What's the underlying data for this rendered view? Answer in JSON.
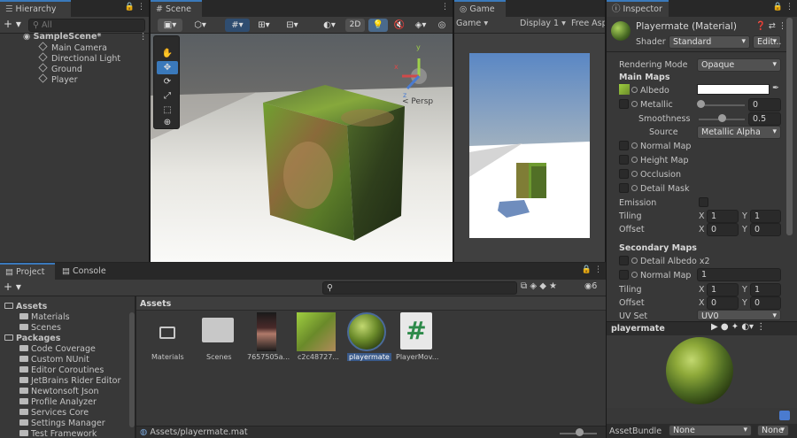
{
  "hierarchy": {
    "tab": "Hierarchy",
    "search_placeholder": "All",
    "scene": "SampleScene*",
    "items": [
      "Main Camera",
      "Directional Light",
      "Ground",
      "Player"
    ]
  },
  "scene": {
    "tab": "Scene",
    "mode_2d": "2D",
    "persp": "< Persp"
  },
  "game": {
    "tab": "Game",
    "display_dropdown": "Game",
    "display": "Display 1",
    "aspect": "Free Asp"
  },
  "inspector": {
    "tab": "Inspector",
    "material_name": "Playermate (Material)",
    "shader_label": "Shader",
    "shader_value": "Standard",
    "edit_button": "Edit...",
    "rendering_mode_label": "Rendering Mode",
    "rendering_mode_value": "Opaque",
    "main_maps_heading": "Main Maps",
    "albedo": "Albedo",
    "metallic": "Metallic",
    "metallic_value": "0",
    "smoothness": "Smoothness",
    "smoothness_value": "0.5",
    "source": "Source",
    "source_value": "Metallic Alpha",
    "normal_map": "Normal Map",
    "height_map": "Height Map",
    "occlusion": "Occlusion",
    "detail_mask": "Detail Mask",
    "emission": "Emission",
    "tiling": "Tiling",
    "offset": "Offset",
    "x": "X",
    "y": "Y",
    "tiling_x": "1",
    "tiling_y": "1",
    "offset_x": "0",
    "offset_y": "0",
    "secondary_maps_heading": "Secondary Maps",
    "detail_albedo": "Detail Albedo x2",
    "normal_map_2": "Normal Map",
    "normal_map_2_value": "1",
    "tiling2_x": "1",
    "tiling2_y": "1",
    "offset2_x": "0",
    "offset2_y": "0",
    "uv_set": "UV Set",
    "uv_set_value": "UV0",
    "preview_name": "playermate",
    "assetbundle_label": "AssetBundle",
    "assetbundle_value": "None",
    "assetbundle_variant": "None"
  },
  "project": {
    "tab_project": "Project",
    "tab_console": "Console",
    "hidden_count": "6",
    "assets_header": "Assets",
    "tree": [
      {
        "label": "Assets",
        "bold": true
      },
      {
        "label": "Materials"
      },
      {
        "label": "Scenes"
      },
      {
        "label": "Packages",
        "bold": true
      },
      {
        "label": "Code Coverage"
      },
      {
        "label": "Custom NUnit"
      },
      {
        "label": "Editor Coroutines"
      },
      {
        "label": "JetBrains Rider Editor"
      },
      {
        "label": "Newtonsoft Json"
      },
      {
        "label": "Profile Analyzer"
      },
      {
        "label": "Services Core"
      },
      {
        "label": "Settings Manager"
      },
      {
        "label": "Test Framework"
      }
    ],
    "assets": [
      "Materials",
      "Scenes",
      "7657505a...",
      "c2c48727...",
      "playermate",
      "PlayerMov..."
    ],
    "status_path": "Assets/playermate.mat"
  },
  "colors": {
    "accent": "#3a79bb",
    "panel": "#383838",
    "tabbar": "#282828"
  }
}
